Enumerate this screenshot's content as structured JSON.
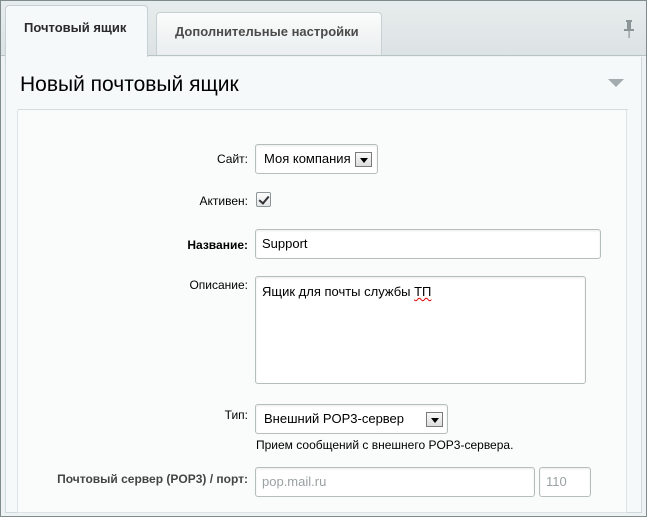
{
  "tabs": [
    {
      "label": "Почтовый ящик",
      "active": true
    },
    {
      "label": "Дополнительные настройки",
      "active": false
    }
  ],
  "icons": {
    "pin": "pin-icon",
    "collapse": "collapse-triangle-icon",
    "checkmark": "checkmark-icon",
    "dropdown": "dropdown-arrow-icon"
  },
  "page_title": "Новый почтовый ящик",
  "form": {
    "site": {
      "label": "Сайт:",
      "value": "Моя компания"
    },
    "active": {
      "label": "Активен:",
      "checked": true
    },
    "name": {
      "label": "Название:",
      "value": "Support"
    },
    "description": {
      "label": "Описание:",
      "value_main": "Ящик для почты службы ",
      "value_underlined": "ТП"
    },
    "type": {
      "label": "Тип:",
      "value": "Внешний POP3-сервер",
      "hint": "Прием сообщений с внешнего POP3-сервера."
    },
    "server": {
      "label": "Почтовый сервер (POP3) / порт:",
      "host_placeholder": "pop.mail.ru",
      "separator": ":",
      "port_placeholder": "110"
    }
  },
  "colors": {
    "tab_bar": "#e2e8e9",
    "panel": "#f5f9f9",
    "border": "#b5bdbf",
    "placeholder": "#9aa1a3"
  }
}
